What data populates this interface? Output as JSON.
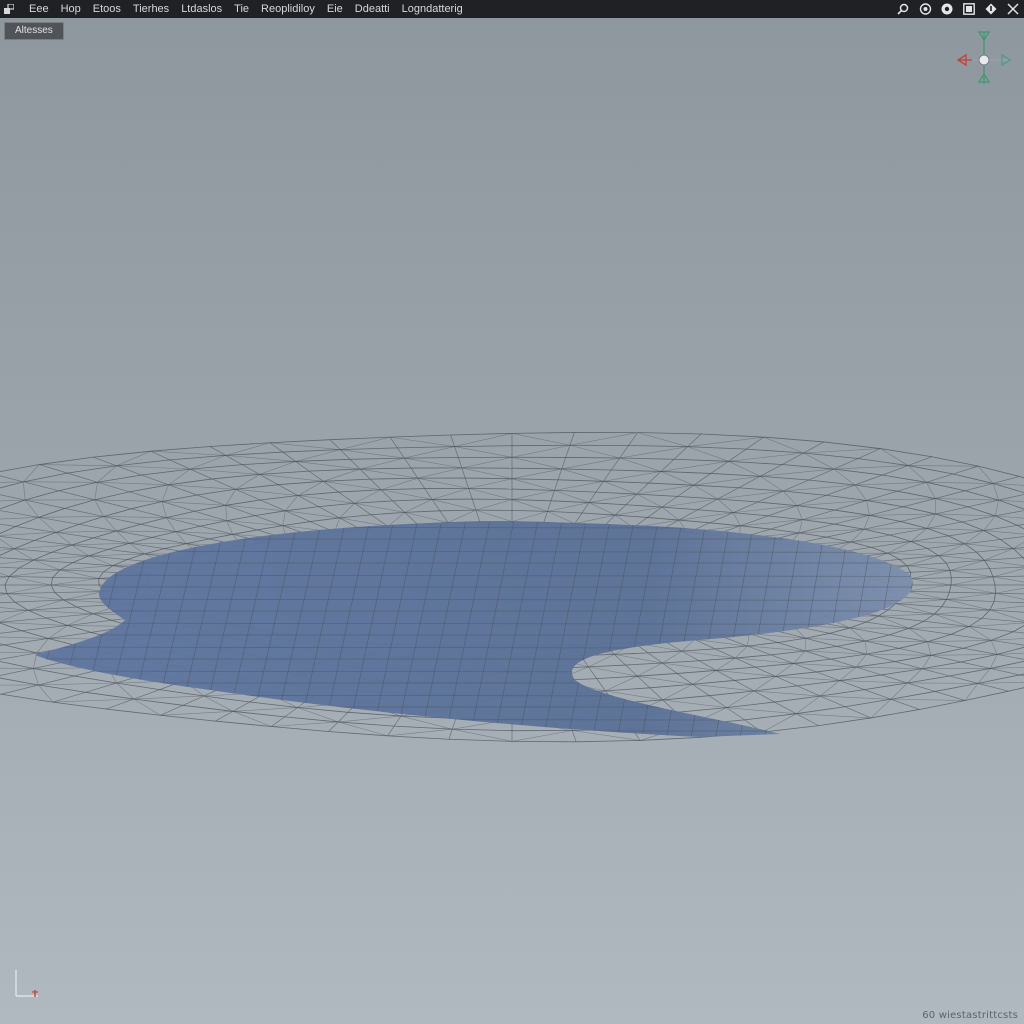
{
  "menubar": {
    "app_icon": "app-logo-icon",
    "items": [
      "Eee",
      "Hop",
      "Etoos",
      "Tierhes",
      "Ltdaslos",
      "Tie",
      "Reoplidiloy",
      "Eie",
      "Ddeatti",
      "Logndatterig"
    ]
  },
  "toolbar": {
    "icons": [
      "search-icon",
      "view-toggle-icon",
      "record-icon",
      "layout-icon",
      "info-icon",
      "close-icon"
    ]
  },
  "viewport": {
    "label": "Altesses",
    "status_text": "60 wiestastrittcsts",
    "axis_icon": "axis-indicator-icon",
    "gizmo_icon": "navigation-gizmo-icon"
  },
  "colors": {
    "menubar_bg": "#1f2124",
    "wire": "#4a5058",
    "fill": "#5d7498",
    "gizmo_x": "#c0463c",
    "gizmo_y": "#3a9a6a"
  }
}
